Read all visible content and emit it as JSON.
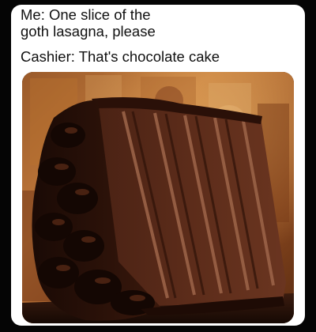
{
  "meme": {
    "caption_lines": [
      "Me: One slice of the",
      "goth lasagna, please",
      "Cashier: That's chocolate cake"
    ]
  },
  "photo": {
    "icon": "chocolate-layer-cake-slice-photo"
  }
}
